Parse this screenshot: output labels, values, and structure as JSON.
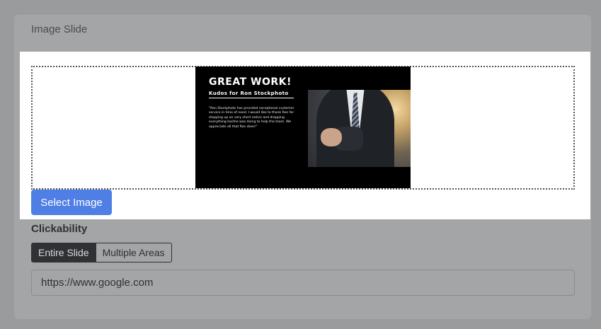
{
  "card": {
    "title": "Image Slide"
  },
  "slide_preview": {
    "heading": "GREAT WORK!",
    "subheading": "Kudos for Ron Stockphoto",
    "quote": "\"Ron Stockphoto has provided exceptional customer service in time of need. I would like to thank Ron for stepping up on very short notice and dropping everything he/she was doing to help the team. We appreciate all that Ron does!\""
  },
  "actions": {
    "select_image_label": "Select Image"
  },
  "clickability": {
    "label": "Clickability",
    "options": [
      "Entire Slide",
      "Multiple Areas"
    ],
    "selected": "Entire Slide"
  },
  "url_field": {
    "value": "https://www.google.com"
  },
  "colors": {
    "primary": "#4f7fe5",
    "segment_active": "#2f3134",
    "overlay": "#9a9b9d"
  }
}
